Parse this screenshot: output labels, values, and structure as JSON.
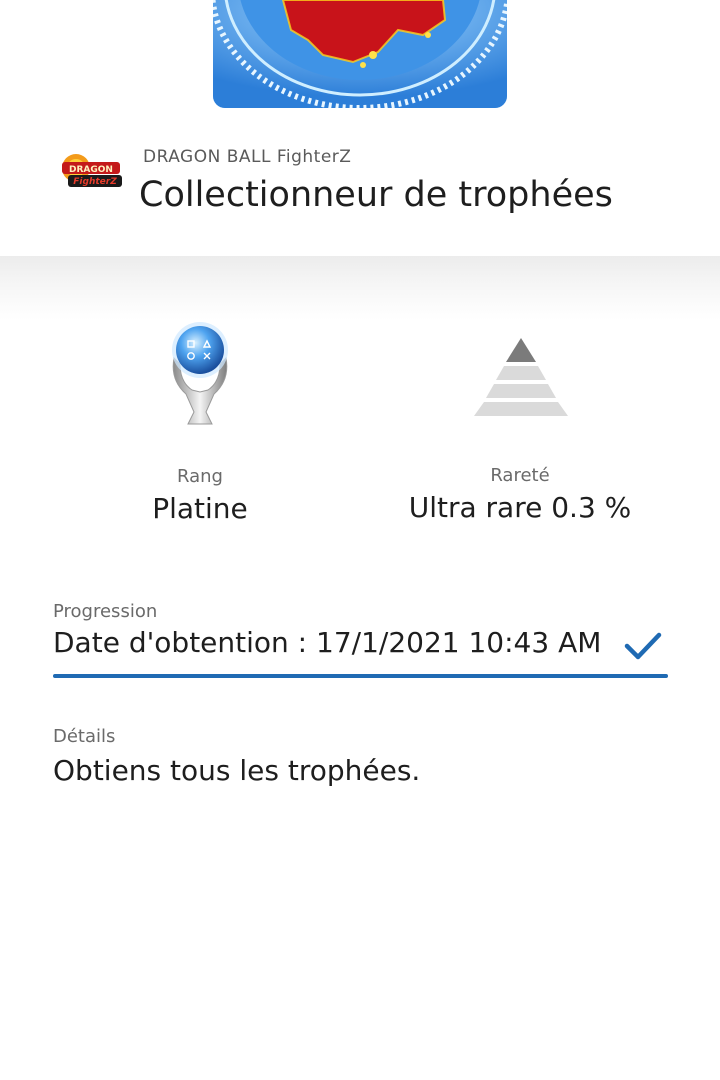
{
  "game": {
    "name": "DRAGON BALL FighterZ",
    "logo_text": "DRAGON BALL FighterZ"
  },
  "trophy": {
    "title": "Collectionneur de trophées",
    "icon": "platinum-trophy-icon"
  },
  "stats": {
    "rank_label": "Rang",
    "rank_value": "Platine",
    "rarity_label": "Rareté",
    "rarity_value": "Ultra rare 0.3 %",
    "rarity_icon": "rarity-pyramid-icon"
  },
  "progression": {
    "label": "Progression",
    "value": "Date d'obtention : 17/1/2021  10:43 AM",
    "status_icon": "check-icon",
    "fraction": 1.0
  },
  "details": {
    "label": "Détails",
    "value": "Obtiens tous les trophées."
  },
  "colors": {
    "accent": "#1f6ab3",
    "text_primary": "#1e1e1e",
    "text_secondary": "#6a6a6a"
  }
}
